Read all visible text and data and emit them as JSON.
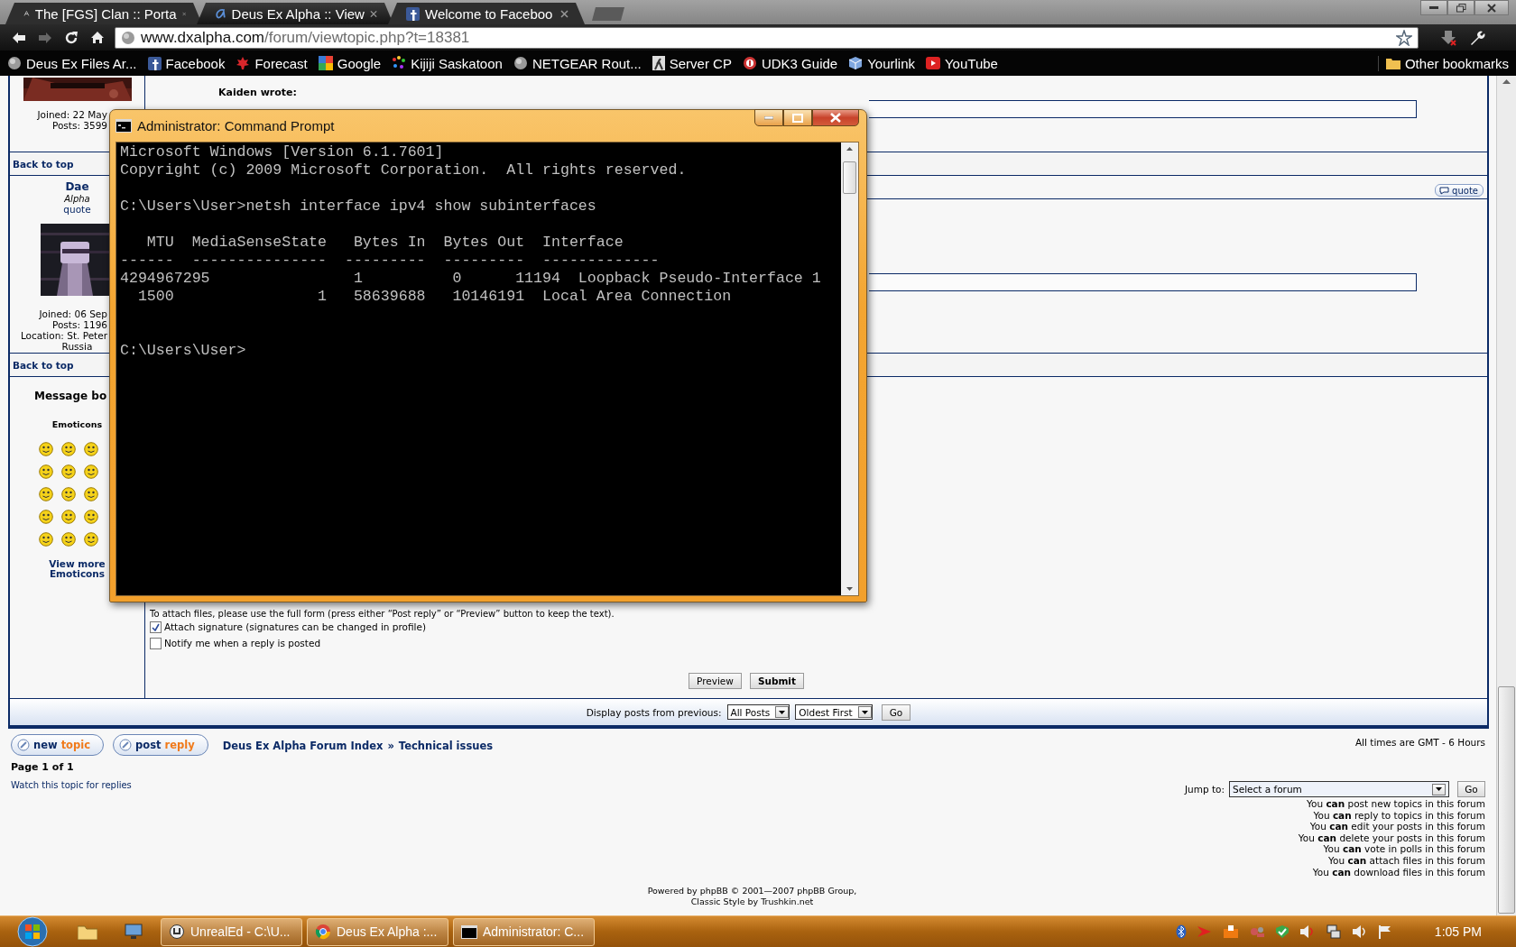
{
  "browser": {
    "tabs": [
      {
        "title": "The [FGS] Clan :: Porta",
        "kind": "dx",
        "selected": false
      },
      {
        "title": "Deus Ex Alpha :: View",
        "kind": "alpha",
        "selected": true
      },
      {
        "title": "Welcome to Faceboo",
        "kind": "facebook",
        "selected": false
      }
    ],
    "address": {
      "host": "www.dxalpha.com",
      "path": "/forum/viewtopic.php?t=18381"
    },
    "bookmarks": [
      {
        "label": "Deus Ex Files Ar...",
        "kind": "globe"
      },
      {
        "label": "Facebook",
        "kind": "facebook"
      },
      {
        "label": "Forecast",
        "kind": "leaf"
      },
      {
        "label": "Google",
        "kind": "tiles"
      },
      {
        "label": "Kijiji Saskatoon",
        "kind": "dots"
      },
      {
        "label": "NETGEAR Rout...",
        "kind": "globe"
      },
      {
        "label": "Server CP",
        "kind": "figure"
      },
      {
        "label": "UDK3 Guide",
        "kind": "ring"
      },
      {
        "label": "Yourlink",
        "kind": "cube"
      },
      {
        "label": "YouTube",
        "kind": "play"
      }
    ],
    "other_bookmarks": "Other bookmarks"
  },
  "forum": {
    "posts": [
      {
        "joined": "Joined: 22 May",
        "posts": "Posts: 3599",
        "quote_author": "Kaiden wrote:",
        "back_to_top": "Back to top"
      },
      {
        "author": "Dae",
        "rank": "Alpha",
        "quote_link": "quote",
        "joined": "Joined: 06 Sep",
        "posts": "Posts: 1196",
        "location": "Location: St. Peter",
        "country": "Russia",
        "quote_button": "quote",
        "back_to_top": "Back to top"
      }
    ],
    "message_body_label": "Message bo",
    "emoticons_title": "Emoticons",
    "view_more": [
      "View more",
      "Emoticons"
    ],
    "attach_note": "To attach files, please use the full form (press either “Post reply” or “Preview” button to keep the text).",
    "options": [
      {
        "label": "Attach signature (signatures can be changed in profile)",
        "checked": true
      },
      {
        "label": "Notify me when a reply is posted",
        "checked": false
      }
    ],
    "buttons": [
      {
        "label": "Preview",
        "kind": "normal"
      },
      {
        "label": "Submit",
        "kind": "primary"
      }
    ],
    "display_bar": {
      "label": "Display posts from previous:",
      "selects": [
        "All Posts",
        "Oldest First"
      ],
      "go": "Go"
    },
    "actions": [
      {
        "main": "new",
        "accent": "topic"
      },
      {
        "main": "post",
        "accent": "reply"
      }
    ],
    "breadcrumb": [
      "Deus Ex Alpha Forum Index",
      "Technical issues"
    ],
    "breadcrumb_separator": "»",
    "timezone": "All times are GMT - 6 Hours",
    "pagination": "Page 1 of 1",
    "watch": "Watch this topic for replies",
    "jump": {
      "label": "Jump to:",
      "select": "Select a forum",
      "go": "Go"
    },
    "permissions": [
      "You **can** post new topics in this forum",
      "You **can** reply to topics in this forum",
      "You **can** edit your posts in this forum",
      "You **can** delete your posts in this forum",
      "You **can** vote in polls in this forum",
      "You **can** attach files in this forum",
      "You **can** download files in this forum"
    ],
    "footer": [
      "Powered by phpBB © 2001—2007 phpBB Group,",
      "Classic Style by Trushkin.net"
    ]
  },
  "cmd": {
    "title": "Administrator: Command Prompt",
    "blocks": [
      {
        "kind": "text",
        "lines": [
          "Microsoft Windows [Version 6.1.7601]",
          "Copyright (c) 2009 Microsoft Corporation.  All rights reserved."
        ]
      },
      {
        "kind": "text",
        "lines": [
          "C:\\Users\\User>netsh interface ipv4 show subinterfaces"
        ]
      },
      {
        "kind": "table",
        "lines": [
          "   MTU  MediaSenseState   Bytes In  Bytes Out  Interface",
          "------  ---------------  ---------  ---------  -------------",
          "4294967295                1          0      11194  Loopback Pseudo-Interface 1",
          "  1500                1   58639688   10146191  Local Area Connection"
        ]
      },
      {
        "kind": "text",
        "lines": [
          "C:\\Users\\User>"
        ]
      }
    ]
  },
  "taskbar": {
    "buttons": [
      {
        "label": "UnrealEd - C:\\U...",
        "kind": "unreal"
      },
      {
        "label": "Deus Ex Alpha :...",
        "kind": "chrome"
      },
      {
        "label": "Administrator: C...",
        "kind": "cmd"
      }
    ],
    "clock": "1:05 PM"
  }
}
